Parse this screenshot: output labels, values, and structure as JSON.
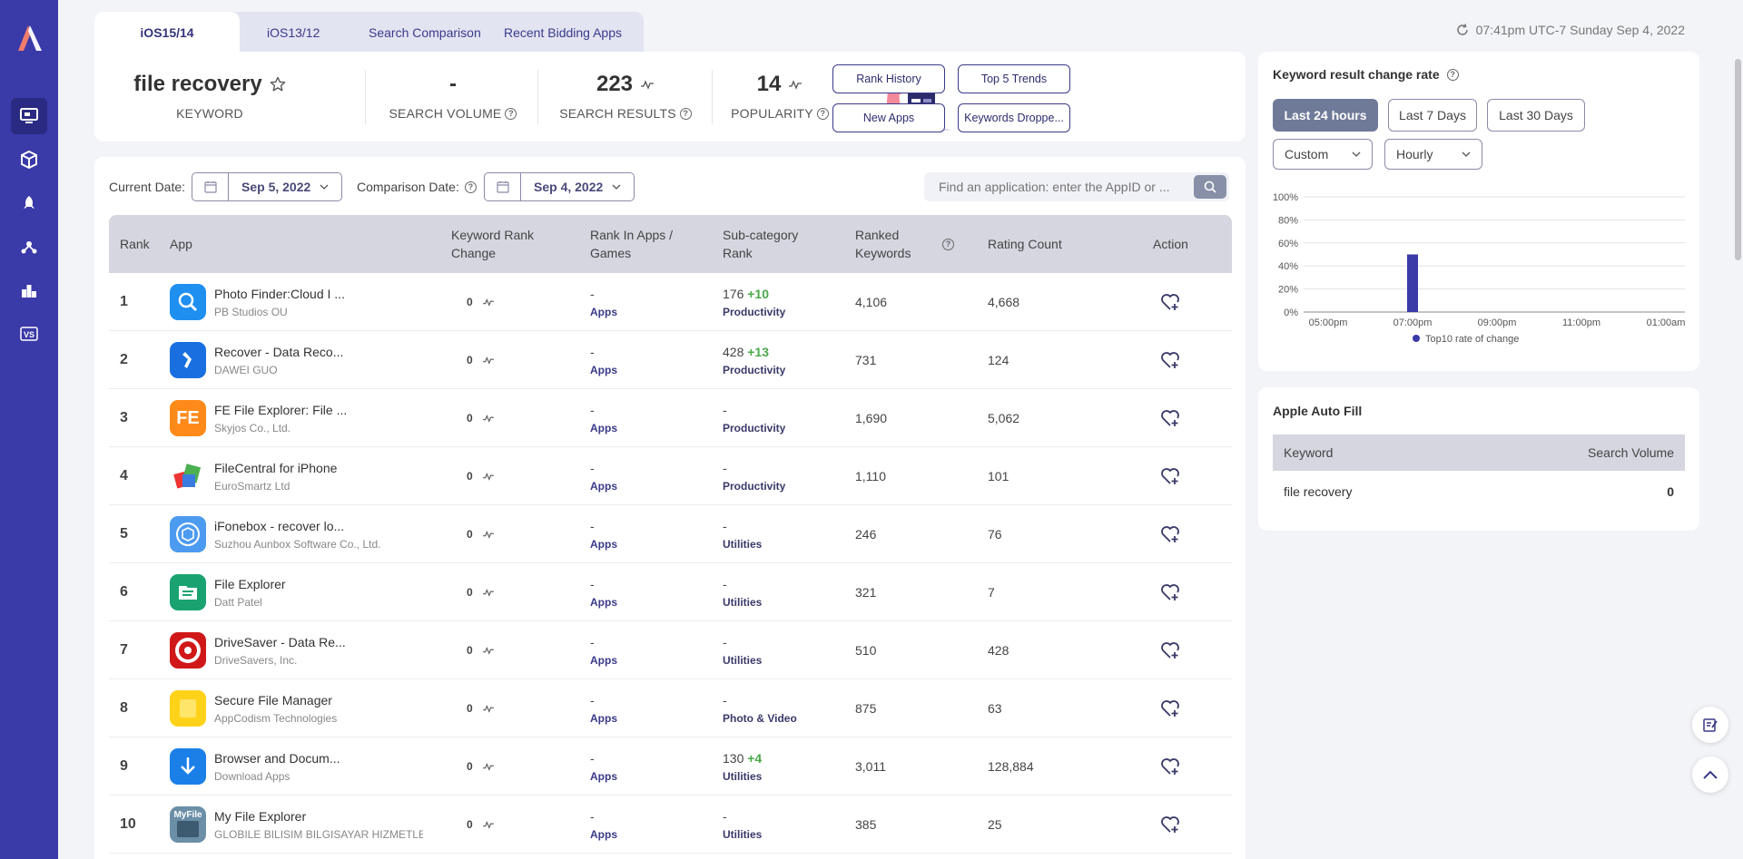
{
  "tabs": [
    {
      "label": "iOS15/14"
    },
    {
      "label": "iOS13/12"
    },
    {
      "label": "Search Comparison"
    },
    {
      "label": "Recent Bidding Apps"
    }
  ],
  "timestamp": "07:41pm UTC-7 Sunday Sep 4, 2022",
  "keyword": {
    "name": "file recovery",
    "keyword_label": "KEYWORD",
    "search_volume": "-",
    "search_volume_label": "SEARCH VOLUME",
    "search_results": "223",
    "search_results_label": "SEARCH RESULTS",
    "popularity": "14",
    "popularity_label": "POPULARITY"
  },
  "actions": {
    "rank_history": "Rank History",
    "top5_trends": "Top 5 Trends",
    "new_apps": "New Apps",
    "keywords_dropped": "Keywords Droppe..."
  },
  "filters": {
    "current_date_label": "Current Date:",
    "current_date": "Sep 5, 2022",
    "comparison_date_label": "Comparison Date:",
    "comparison_date": "Sep 4, 2022",
    "search_placeholder": "Find an application: enter the AppID or ..."
  },
  "table": {
    "headers": {
      "rank": "Rank",
      "app": "App",
      "kw_change_1": "Keyword Rank",
      "kw_change_2": "Change",
      "rank_apps_1": "Rank In Apps /",
      "rank_apps_2": "Games",
      "subcat_1": "Sub-category",
      "subcat_2": "Rank",
      "ranked_1": "Ranked",
      "ranked_2": "Keywords",
      "rating": "Rating Count",
      "action": "Action"
    },
    "rows": [
      {
        "rank": "1",
        "name": "Photo Finder:Cloud I ...",
        "dev": "PB Studios OU",
        "change": "0",
        "rank_apps": "-",
        "rank_apps_type": "Apps",
        "subcat_rank": "176",
        "subcat_delta": "+10",
        "subcat": "Productivity",
        "ranked": "4,106",
        "rating": "4,668"
      },
      {
        "rank": "2",
        "name": "Recover - Data Reco...",
        "dev": "DAWEI GUO",
        "change": "0",
        "rank_apps": "-",
        "rank_apps_type": "Apps",
        "subcat_rank": "428",
        "subcat_delta": "+13",
        "subcat": "Productivity",
        "ranked": "731",
        "rating": "124"
      },
      {
        "rank": "3",
        "name": "FE File Explorer: File ...",
        "dev": "Skyjos Co., Ltd.",
        "change": "0",
        "rank_apps": "-",
        "rank_apps_type": "Apps",
        "subcat_rank": "-",
        "subcat_delta": "",
        "subcat": "Productivity",
        "ranked": "1,690",
        "rating": "5,062"
      },
      {
        "rank": "4",
        "name": "FileCentral for iPhone",
        "dev": "EuroSmartz Ltd",
        "change": "0",
        "rank_apps": "-",
        "rank_apps_type": "Apps",
        "subcat_rank": "-",
        "subcat_delta": "",
        "subcat": "Productivity",
        "ranked": "1,110",
        "rating": "101"
      },
      {
        "rank": "5",
        "name": "iFonebox - recover lo...",
        "dev": "Suzhou Aunbox Software Co., Ltd.",
        "change": "0",
        "rank_apps": "-",
        "rank_apps_type": "Apps",
        "subcat_rank": "-",
        "subcat_delta": "",
        "subcat": "Utilities",
        "ranked": "246",
        "rating": "76"
      },
      {
        "rank": "6",
        "name": "File Explorer",
        "dev": "Datt Patel",
        "change": "0",
        "rank_apps": "-",
        "rank_apps_type": "Apps",
        "subcat_rank": "-",
        "subcat_delta": "",
        "subcat": "Utilities",
        "ranked": "321",
        "rating": "7"
      },
      {
        "rank": "7",
        "name": "DriveSaver - Data Re...",
        "dev": "DriveSavers, Inc.",
        "change": "0",
        "rank_apps": "-",
        "rank_apps_type": "Apps",
        "subcat_rank": "-",
        "subcat_delta": "",
        "subcat": "Utilities",
        "ranked": "510",
        "rating": "428"
      },
      {
        "rank": "8",
        "name": "Secure File Manager",
        "dev": "AppCodism Technologies",
        "change": "0",
        "rank_apps": "-",
        "rank_apps_type": "Apps",
        "subcat_rank": "-",
        "subcat_delta": "",
        "subcat": "Photo & Video",
        "ranked": "875",
        "rating": "63"
      },
      {
        "rank": "9",
        "name": "Browser and Docum...",
        "dev": "Download Apps",
        "change": "0",
        "rank_apps": "-",
        "rank_apps_type": "Apps",
        "subcat_rank": "130",
        "subcat_delta": "+4",
        "subcat": "Utilities",
        "ranked": "3,011",
        "rating": "128,884"
      },
      {
        "rank": "10",
        "name": "My File Explorer",
        "dev": "GLOBILE BILISIM BILGISAYAR HIZMETLEF",
        "change": "0",
        "rank_apps": "-",
        "rank_apps_type": "Apps",
        "subcat_rank": "-",
        "subcat_delta": "",
        "subcat": "Utilities",
        "ranked": "385",
        "rating": "25"
      }
    ]
  },
  "change_rate": {
    "title": "Keyword result change rate",
    "btn_24h": "Last 24 hours",
    "btn_7d": "Last 7 Days",
    "btn_30d": "Last 30 Days",
    "custom": "Custom",
    "interval": "Hourly"
  },
  "chart_data": {
    "type": "bar",
    "y_ticks": [
      "100%",
      "80%",
      "60%",
      "40%",
      "20%",
      "0%"
    ],
    "x_ticks": [
      "05:00pm",
      "07:00pm",
      "09:00pm",
      "11:00pm",
      "01:00am"
    ],
    "ylim": [
      0,
      100
    ],
    "series": [
      {
        "name": "Top10 rate of change",
        "points": [
          {
            "x": "07:00pm",
            "y": 50
          }
        ]
      }
    ],
    "grid": true,
    "legend": "bottom",
    "color": "#3a3aa8"
  },
  "autofill": {
    "title": "Apple Auto Fill",
    "col_keyword": "Keyword",
    "col_volume": "Search Volume",
    "rows": [
      {
        "keyword": "file recovery",
        "volume": "0"
      }
    ]
  },
  "colors": {
    "sidebar": "#3a3aa8",
    "accent": "#3a3a8a",
    "positive": "#4aa84a"
  }
}
